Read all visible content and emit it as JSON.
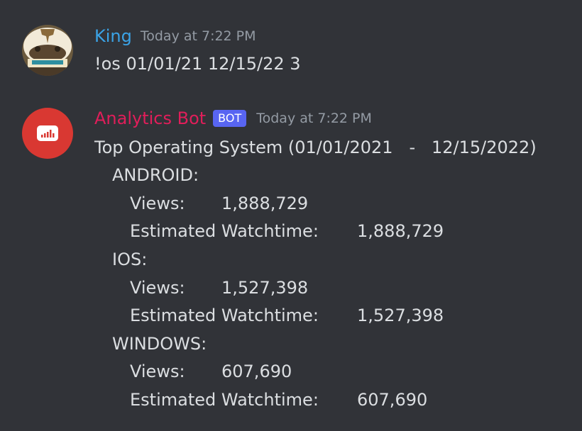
{
  "messages": {
    "user": {
      "author": "King",
      "author_color": "#3ba3e6",
      "timestamp": "Today at 7:22 PM",
      "text": "!os 01/01/21 12/15/22 3"
    },
    "bot": {
      "author": "Analytics Bot",
      "author_color": "#e01e5a",
      "badge": "BOT",
      "timestamp": "Today at 7:22 PM",
      "avatar_icon": "bar-chart-icon",
      "avatar_color": "#d93832",
      "title": "Top Operating System (01/01/2021   -   12/15/2022)",
      "sections": [
        {
          "name": "ANDROID:",
          "views_label": "Views:",
          "views": "1,888,729",
          "watch_label": "Estimated Watchtime:",
          "watch": "1,888,729"
        },
        {
          "name": "IOS:",
          "views_label": "Views:",
          "views": "1,527,398",
          "watch_label": "Estimated Watchtime:",
          "watch": "1,527,398"
        },
        {
          "name": "WINDOWS:",
          "views_label": "Views:",
          "views": "607,690",
          "watch_label": "Estimated Watchtime:",
          "watch": "607,690"
        }
      ]
    }
  }
}
